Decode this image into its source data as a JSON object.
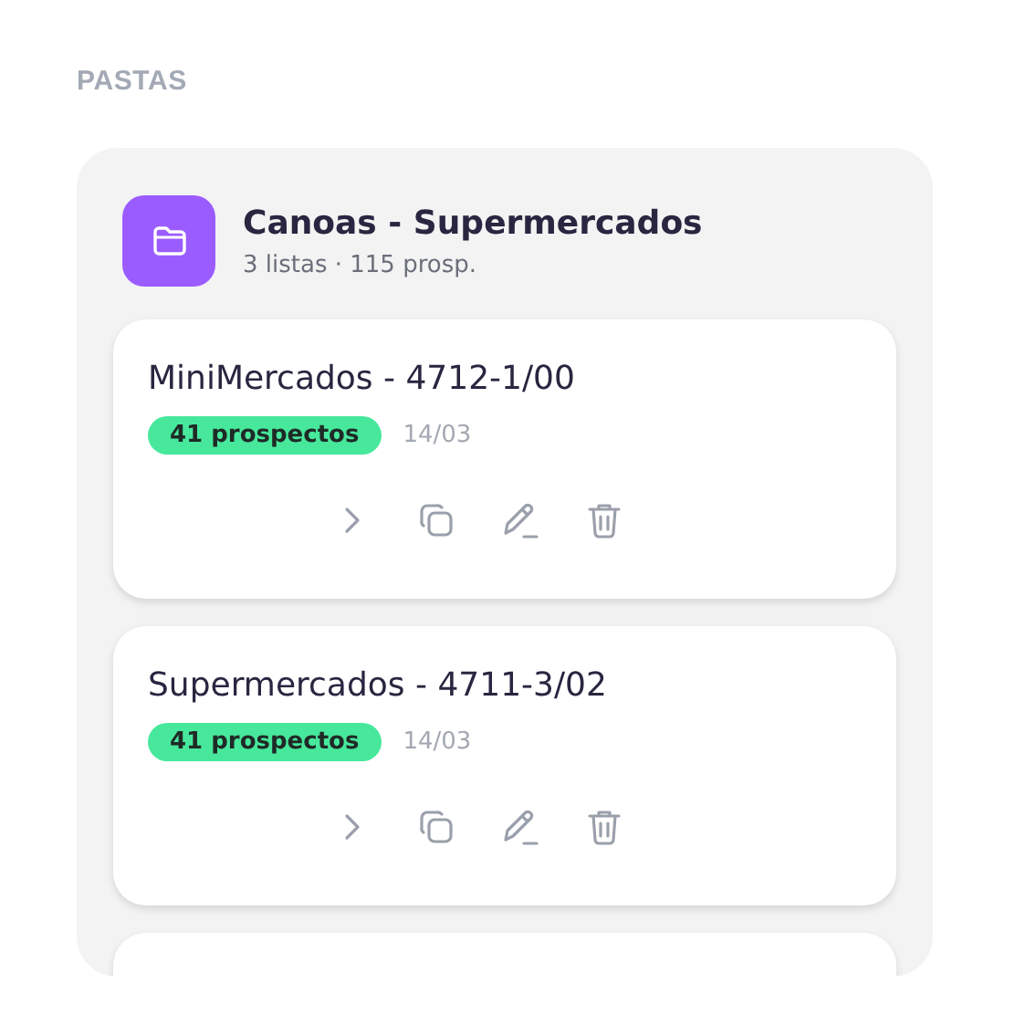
{
  "section_title": "PASTAS",
  "folder": {
    "name": "Canoas - Supermercados",
    "summary": "3 listas · 115 prosp.",
    "lists": [
      {
        "name": "MiniMercados - 4712-1/00",
        "badge": "41 prospectos",
        "date": "14/03"
      },
      {
        "name": "Supermercados - 4711-3/02",
        "badge": "41 prospectos",
        "date": "14/03"
      }
    ]
  }
}
